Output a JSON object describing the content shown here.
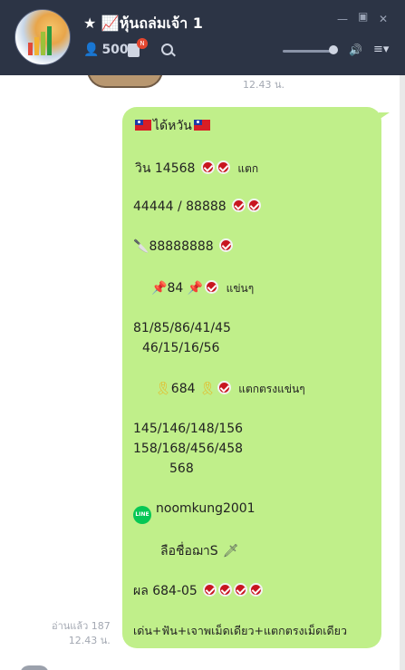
{
  "header": {
    "title": "★ 📈หุ้นถล่มเจ้า 1",
    "member_count": "500",
    "notes_badge": "N"
  },
  "chat": {
    "top_timestamp": "12.43 น.",
    "message": {
      "line1": "ได้หวัน",
      "line2_text": "วิน  14568",
      "line2_suffix": "แตก",
      "line3": "44444 / 88888",
      "line4": "88888888",
      "line5_num": "84",
      "line5_suffix": "แข่นๆ",
      "line6a": "81/85/86/41/45",
      "line6b": "46/15/16/56",
      "line7_num": "684",
      "line7_suffix": "แตกตรงแข่นๆ",
      "line8a": "145/146/148/156",
      "line8b": "158/168/456/458",
      "line8c": "568",
      "line9": "noomkung2001",
      "line10": "ลือชื่อฌาS",
      "line11": "ผล 684-05",
      "line12": "เด่น+ฟัน+เจาพเม็ดเดียว+แตกตรงเม็ดเดียว"
    },
    "read_status": "อ่านแล้ว 187",
    "message_timestamp": "12.43 น."
  },
  "colors": {
    "header_bg": "#2c3445",
    "bubble_bg": "#c0ef8a",
    "check_red": "#c8151f"
  },
  "icons": [
    "avatar",
    "chart-emoji-icon",
    "members-icon",
    "notes-icon",
    "search-icon",
    "minimize-icon",
    "maximize-icon",
    "close-icon",
    "speaker-icon",
    "menu-icon"
  ]
}
